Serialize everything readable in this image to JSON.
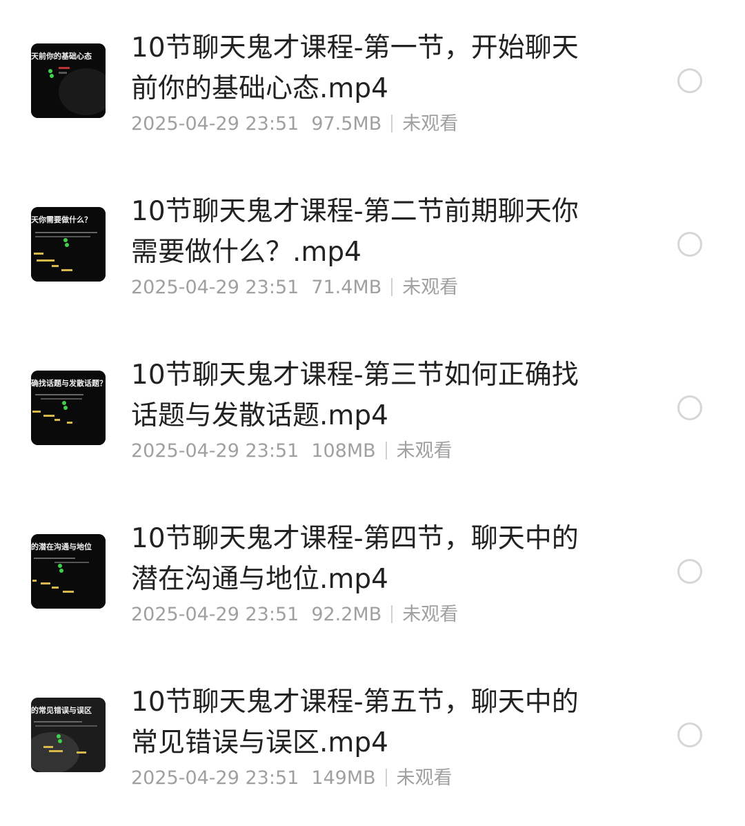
{
  "files": [
    {
      "title": "10节聊天鬼才课程-第一节，开始聊天前你的基础心态.mp4",
      "thumb_caption": "天前你的基础心态",
      "date": "2025-04-29 23:51",
      "size": "97.5MB",
      "status": "未观看"
    },
    {
      "title": "10节聊天鬼才课程-第二节前期聊天你需要做什么？.mp4",
      "thumb_caption": "天你需要做什么？",
      "date": "2025-04-29 23:51",
      "size": "71.4MB",
      "status": "未观看"
    },
    {
      "title": "10节聊天鬼才课程-第三节如何正确找话题与发散话题.mp4",
      "thumb_caption": "确找话题与发散话题？",
      "date": "2025-04-29 23:51",
      "size": "108MB",
      "status": "未观看"
    },
    {
      "title": "10节聊天鬼才课程-第四节，聊天中的潜在沟通与地位.mp4",
      "thumb_caption": "的潜在沟通与地位",
      "date": "2025-04-29 23:51",
      "size": "92.2MB",
      "status": "未观看"
    },
    {
      "title": "10节聊天鬼才课程-第五节，聊天中的常见错误与误区.mp4",
      "thumb_caption": "的常见错误与误区",
      "date": "2025-04-29 23:51",
      "size": "149MB",
      "status": "未观看"
    }
  ],
  "icons": {
    "thumbnail": "video-thumbnail-icon",
    "select": "radio-unselected-icon"
  },
  "colors": {
    "title": "#222222",
    "meta": "#a0a0a0",
    "radio_border": "#d6d6d6",
    "thumb_bg": "#0a0a0a",
    "thumb_green": "#3fd14a",
    "thumb_yellow": "#d9b84a"
  }
}
